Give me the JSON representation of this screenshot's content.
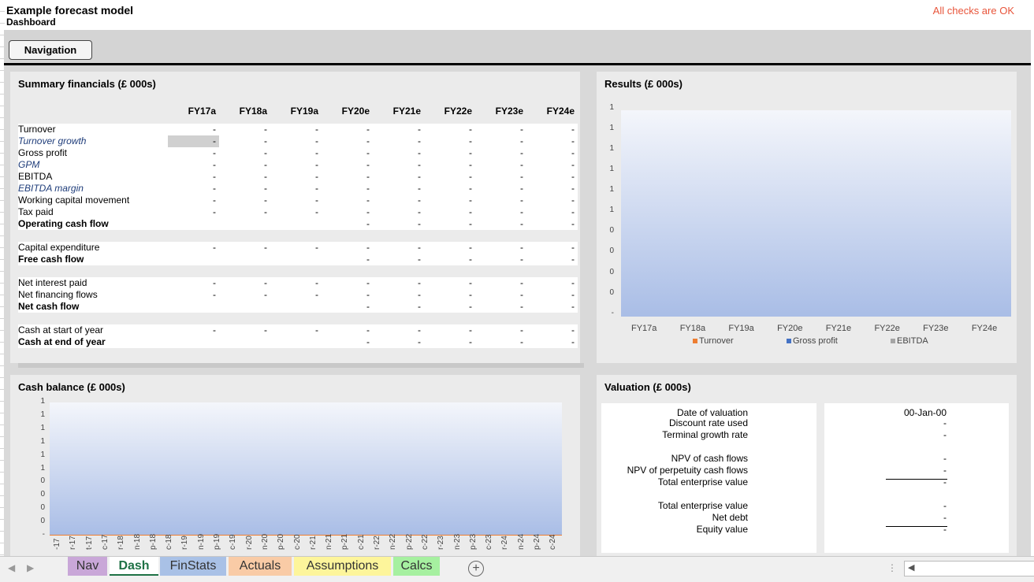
{
  "header": {
    "title": "Example forecast model",
    "subtitle": "Dashboard",
    "checks": "All checks are OK",
    "checks_color": "#e8553b"
  },
  "nav": {
    "button": "Navigation"
  },
  "summary": {
    "title": "Summary financials (£ 000s)",
    "years": [
      "FY17a",
      "FY18a",
      "FY19a",
      "FY20e",
      "FY21e",
      "FY22e",
      "FY23e",
      "FY24e"
    ],
    "rows": [
      {
        "label": "Turnover",
        "style": "normal",
        "vals": [
          "-",
          "-",
          "-",
          "-",
          "-",
          "-",
          "-",
          "-"
        ]
      },
      {
        "label": "Turnover growth",
        "style": "italic",
        "vals": [
          "-",
          "-",
          "-",
          "-",
          "-",
          "-",
          "-",
          "-"
        ]
      },
      {
        "label": "Gross profit",
        "style": "normal",
        "vals": [
          "-",
          "-",
          "-",
          "-",
          "-",
          "-",
          "-",
          "-"
        ]
      },
      {
        "label": "GPM",
        "style": "italic",
        "vals": [
          "-",
          "-",
          "-",
          "-",
          "-",
          "-",
          "-",
          "-"
        ]
      },
      {
        "label": "EBITDA",
        "style": "normal",
        "vals": [
          "-",
          "-",
          "-",
          "-",
          "-",
          "-",
          "-",
          "-"
        ]
      },
      {
        "label": "EBITDA margin",
        "style": "italic",
        "vals": [
          "-",
          "-",
          "-",
          "-",
          "-",
          "-",
          "-",
          "-"
        ]
      },
      {
        "label": "Working capital movement",
        "style": "normal",
        "vals": [
          "-",
          "-",
          "-",
          "-",
          "-",
          "-",
          "-",
          "-"
        ]
      },
      {
        "label": "Tax paid",
        "style": "normal",
        "vals": [
          "-",
          "-",
          "-",
          "-",
          "-",
          "-",
          "-",
          "-"
        ]
      },
      {
        "label": "Operating cash flow",
        "style": "bold",
        "vals": [
          "",
          "",
          "",
          "-",
          "-",
          "-",
          "-",
          "-"
        ]
      },
      {
        "label": "",
        "style": "gap",
        "vals": [
          "",
          "",
          "",
          "",
          "",
          "",
          "",
          ""
        ]
      },
      {
        "label": "Capital expenditure",
        "style": "normal",
        "vals": [
          "-",
          "-",
          "-",
          "-",
          "-",
          "-",
          "-",
          "-"
        ]
      },
      {
        "label": "Free cash flow",
        "style": "bold",
        "vals": [
          "",
          "",
          "",
          "-",
          "-",
          "-",
          "-",
          "-"
        ]
      },
      {
        "label": "",
        "style": "gap",
        "vals": [
          "",
          "",
          "",
          "",
          "",
          "",
          "",
          ""
        ]
      },
      {
        "label": "Net interest paid",
        "style": "normal",
        "vals": [
          "-",
          "-",
          "-",
          "-",
          "-",
          "-",
          "-",
          "-"
        ]
      },
      {
        "label": "Net financing flows",
        "style": "normal",
        "vals": [
          "-",
          "-",
          "-",
          "-",
          "-",
          "-",
          "-",
          "-"
        ]
      },
      {
        "label": "Net cash flow",
        "style": "bold",
        "vals": [
          "",
          "",
          "",
          "-",
          "-",
          "-",
          "-",
          "-"
        ]
      },
      {
        "label": "",
        "style": "gap",
        "vals": [
          "",
          "",
          "",
          "",
          "",
          "",
          "",
          ""
        ]
      },
      {
        "label": "Cash at start of year",
        "style": "normal",
        "vals": [
          "-",
          "-",
          "-",
          "-",
          "-",
          "-",
          "-",
          "-"
        ]
      },
      {
        "label": "Cash at end of year",
        "style": "bold",
        "vals": [
          "",
          "",
          "",
          "-",
          "-",
          "-",
          "-",
          "-"
        ]
      }
    ]
  },
  "results": {
    "title": "Results (£ 000s)",
    "y_ticks": [
      "1",
      "1",
      "1",
      "1",
      "1",
      "1",
      "0",
      "0",
      "0",
      "0",
      "-"
    ],
    "x_ticks": [
      "FY17a",
      "FY18a",
      "FY19a",
      "FY20e",
      "FY21e",
      "FY22e",
      "FY23e",
      "FY24e"
    ],
    "legend": [
      {
        "name": "Turnover",
        "color": "#ed7d31"
      },
      {
        "name": "Gross profit",
        "color": "#4472c4"
      },
      {
        "name": "EBITDA",
        "color": "#a5a5a5"
      }
    ]
  },
  "cash": {
    "title": "Cash balance (£ 000s)",
    "y_ticks": [
      "1",
      "1",
      "1",
      "1",
      "1",
      "1",
      "0",
      "0",
      "0",
      "0",
      "-"
    ],
    "x_ticks": [
      "-17",
      "r-17",
      "t-17",
      "c-17",
      "r-18",
      "n-18",
      "p-18",
      "c-18",
      "r-19",
      "n-19",
      "p-19",
      "c-19",
      "r-20",
      "n-20",
      "p-20",
      "c-20",
      "r-21",
      "n-21",
      "p-21",
      "c-21",
      "r-22",
      "n-22",
      "p-22",
      "c-22",
      "r-23",
      "n-23",
      "p-23",
      "c-23",
      "r-24",
      "n-24",
      "p-24",
      "c-24"
    ],
    "line_color": "#ed7d31"
  },
  "valuation": {
    "title": "Valuation (£ 000s)",
    "rows": [
      {
        "label": "Date of valuation",
        "value": "00-Jan-00"
      },
      {
        "label": "Discount rate used",
        "value": "-"
      },
      {
        "label": "Terminal growth rate",
        "value": "-"
      },
      {
        "label": "NPV of cash flows",
        "value": "-"
      },
      {
        "label": "NPV of perpetuity cash flows",
        "value": "-"
      },
      {
        "label": "Total enterprise value",
        "value": "-"
      },
      {
        "label": "Total enterprise value",
        "value": "-"
      },
      {
        "label": "Net debt",
        "value": "-"
      },
      {
        "label": "Equity value",
        "value": "-"
      }
    ]
  },
  "tabs": [
    {
      "label": "Nav",
      "color": "#c9a7d8",
      "active": false
    },
    {
      "label": "Dash",
      "color": "#ffffff",
      "active": true
    },
    {
      "label": "FinStats",
      "color": "#a9c1e6",
      "active": false
    },
    {
      "label": "Actuals",
      "color": "#f9cba6",
      "active": false
    },
    {
      "label": "Assumptions",
      "color": "#fdf59b",
      "active": false
    },
    {
      "label": "Calcs",
      "color": "#a6f0a0",
      "active": false
    }
  ]
}
